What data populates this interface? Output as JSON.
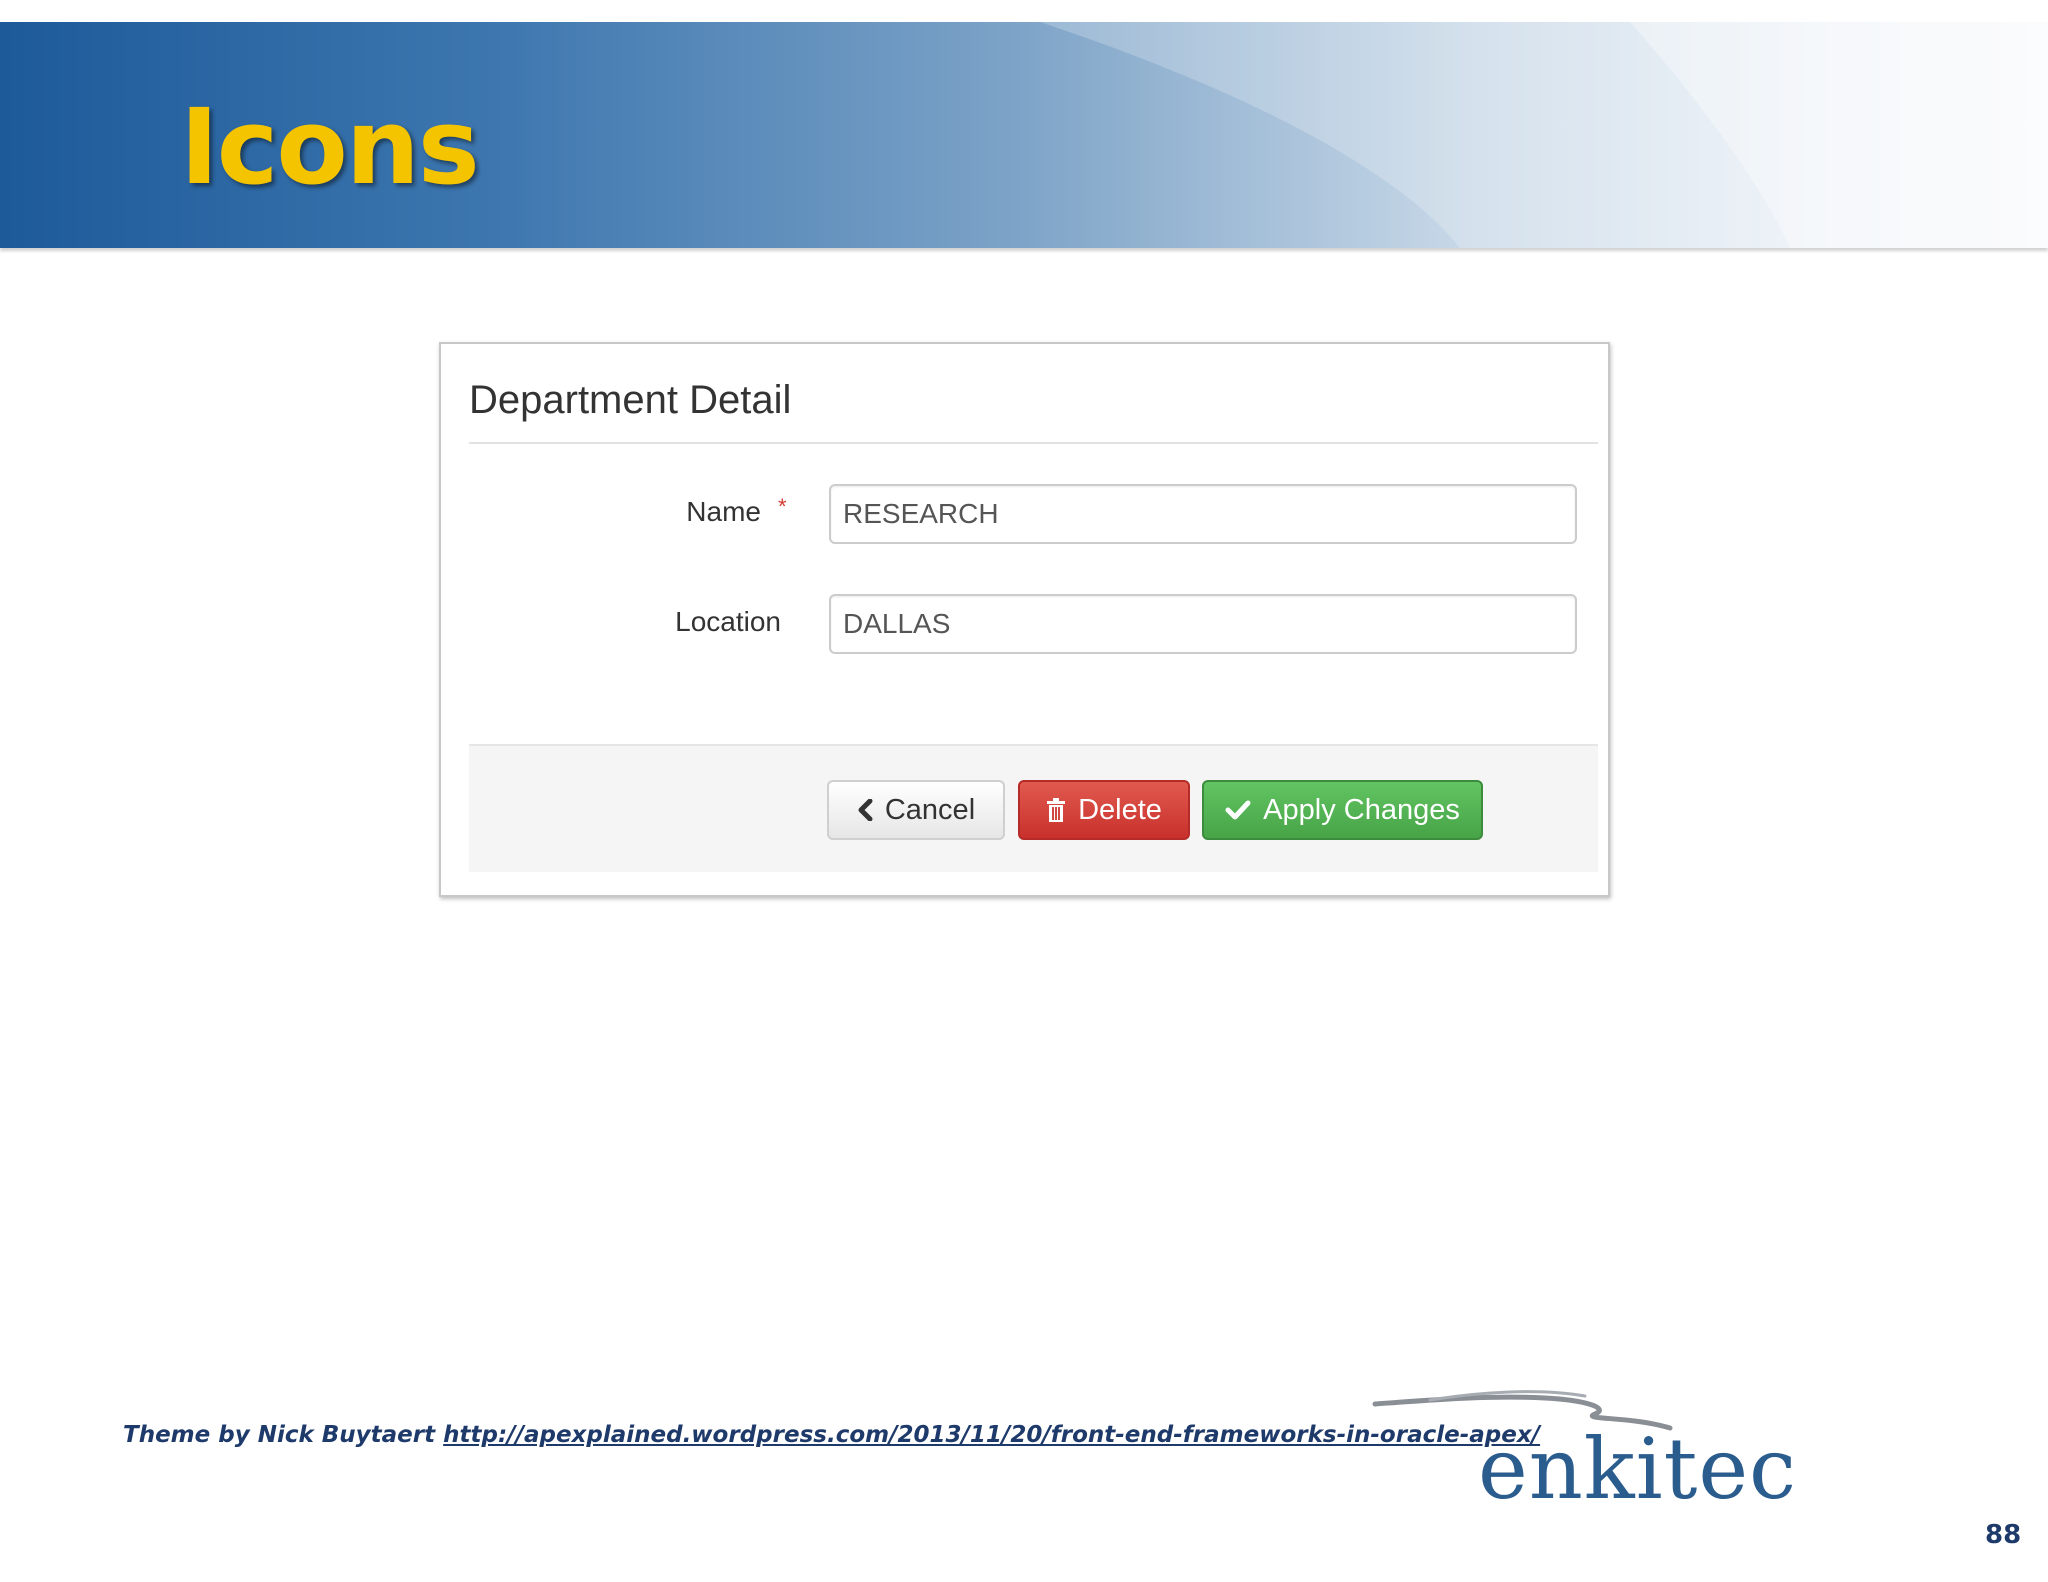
{
  "slide": {
    "title": "Icons",
    "page_number": "88"
  },
  "form": {
    "title": "Department Detail",
    "required_mark": "*",
    "fields": [
      {
        "label": "Name",
        "value": "RESEARCH",
        "required": true
      },
      {
        "label": "Location",
        "value": "DALLAS",
        "required": false
      }
    ],
    "buttons": {
      "cancel": {
        "label": "Cancel",
        "icon": "chevron-left-icon"
      },
      "delete": {
        "label": "Delete",
        "icon": "trash-icon"
      },
      "apply": {
        "label": "Apply Changes",
        "icon": "check-icon"
      }
    }
  },
  "footer": {
    "credit_prefix": "Theme by Nick Buytaert",
    "credit_link": "http://apexplained.wordpress.com/2013/11/20/front-end-frameworks-in-oracle-apex/",
    "logo_text": "enkitec"
  },
  "colors": {
    "title": "#f5c400",
    "banner": "#1d5a9a",
    "delete": "#d9534f",
    "apply": "#5cb85c",
    "logo": "#2b5c8e"
  }
}
